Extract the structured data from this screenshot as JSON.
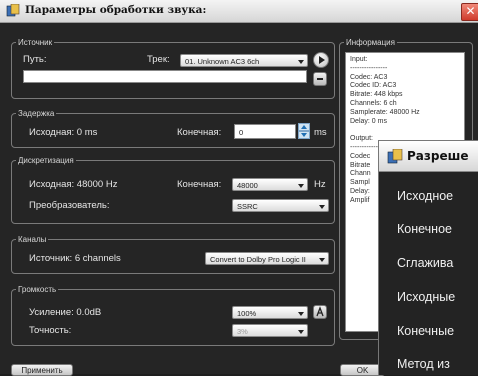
{
  "window": {
    "title": "Параметры обработки звука:",
    "close_glyph": "✕"
  },
  "source": {
    "legend": "Источник",
    "path_label": "Путь:",
    "path_value": "",
    "track_label": "Трек:",
    "track_value": "01. Unknown AC3 6ch"
  },
  "delay": {
    "legend": "Задержка",
    "source_label": "Исходная: 0 ms",
    "target_label": "Конечная:",
    "target_value": "0",
    "unit": "ms"
  },
  "sampling": {
    "legend": "Дискретизация",
    "source_label": "Исходная: 48000 Hz",
    "target_label": "Конечная:",
    "target_value": "48000",
    "unit": "Hz",
    "converter_label": "Преобразователь:",
    "converter_value": "SSRC"
  },
  "channels": {
    "legend": "Каналы",
    "source_label": "Источник: 6 channels",
    "mode_value": "Convert to Dolby Pro Logic II"
  },
  "volume": {
    "legend": "Громкость",
    "gain_label": "Усиление: 0.0dB",
    "gain_value": "100%",
    "precision_label": "Точность:",
    "precision_value": "3%"
  },
  "info": {
    "legend": "Информация",
    "lines": [
      "Input:",
      "----------------",
      "Codec: AC3",
      "Codec ID: AC3",
      "Bitrate: 448 kbps",
      "Channels: 6 ch",
      "Samplerate: 48000 Hz",
      "Delay: 0 ms",
      "",
      "Output:",
      "----------------",
      "Codec",
      "Bitrate",
      "Chann",
      "Sampl",
      "Delay:",
      "Amplif"
    ]
  },
  "bottom": {
    "apply_label": "Применить",
    "ok_label": "OK"
  },
  "overlay": {
    "title": "Разреше",
    "items": [
      "Исходное",
      "Конечное",
      "Сглажива",
      "Исходные",
      "Конечные",
      "Метод из"
    ]
  },
  "colors": {
    "window_bg": "#252525",
    "border": "#7a7a7a",
    "close_red": "#cf3b2c",
    "accent_blue": "#1f6fb3"
  }
}
